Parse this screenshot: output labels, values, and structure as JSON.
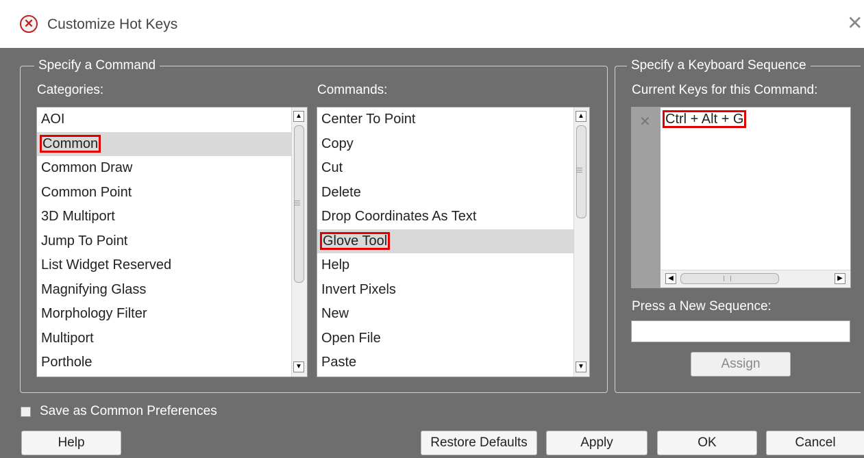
{
  "window": {
    "title": "Customize Hot Keys",
    "close_glyph": "✕",
    "icon": "red-x-circle-icon"
  },
  "command_group": {
    "legend": "Specify a Command",
    "categories_label": "Categories:",
    "commands_label": "Commands:",
    "categories": [
      "AOI",
      "Common",
      "Common Draw",
      "Common Point",
      "3D Multiport",
      "Jump To Point",
      "List Widget Reserved",
      "Magnifying Glass",
      "Morphology Filter",
      "Multiport",
      "Porthole"
    ],
    "categories_selected": "Common",
    "commands": [
      "Center To Point",
      "Copy",
      "Cut",
      "Delete",
      "Drop Coordinates As Text",
      "Glove Tool",
      "Help",
      "Invert Pixels",
      "New",
      "Open File",
      "Paste"
    ],
    "commands_selected": "Glove Tool"
  },
  "keyboard_group": {
    "legend": "Specify a Keyboard Sequence",
    "current_keys_label": "Current Keys for this Command:",
    "current_keys": [
      "Ctrl + Alt + G"
    ],
    "remove_glyph": "✕",
    "new_sequence_label": "Press a New Sequence:",
    "new_sequence_value": "",
    "assign_label": "Assign"
  },
  "save_common": {
    "label": "Save as Common Preferences",
    "checked": false
  },
  "buttons": {
    "help": "Help",
    "restore_defaults": "Restore Defaults",
    "apply": "Apply",
    "ok": "OK",
    "cancel": "Cancel"
  },
  "colors": {
    "dialog_bg": "#6e6e6e",
    "highlight": "#e00000",
    "selection": "#d9d9d9"
  }
}
